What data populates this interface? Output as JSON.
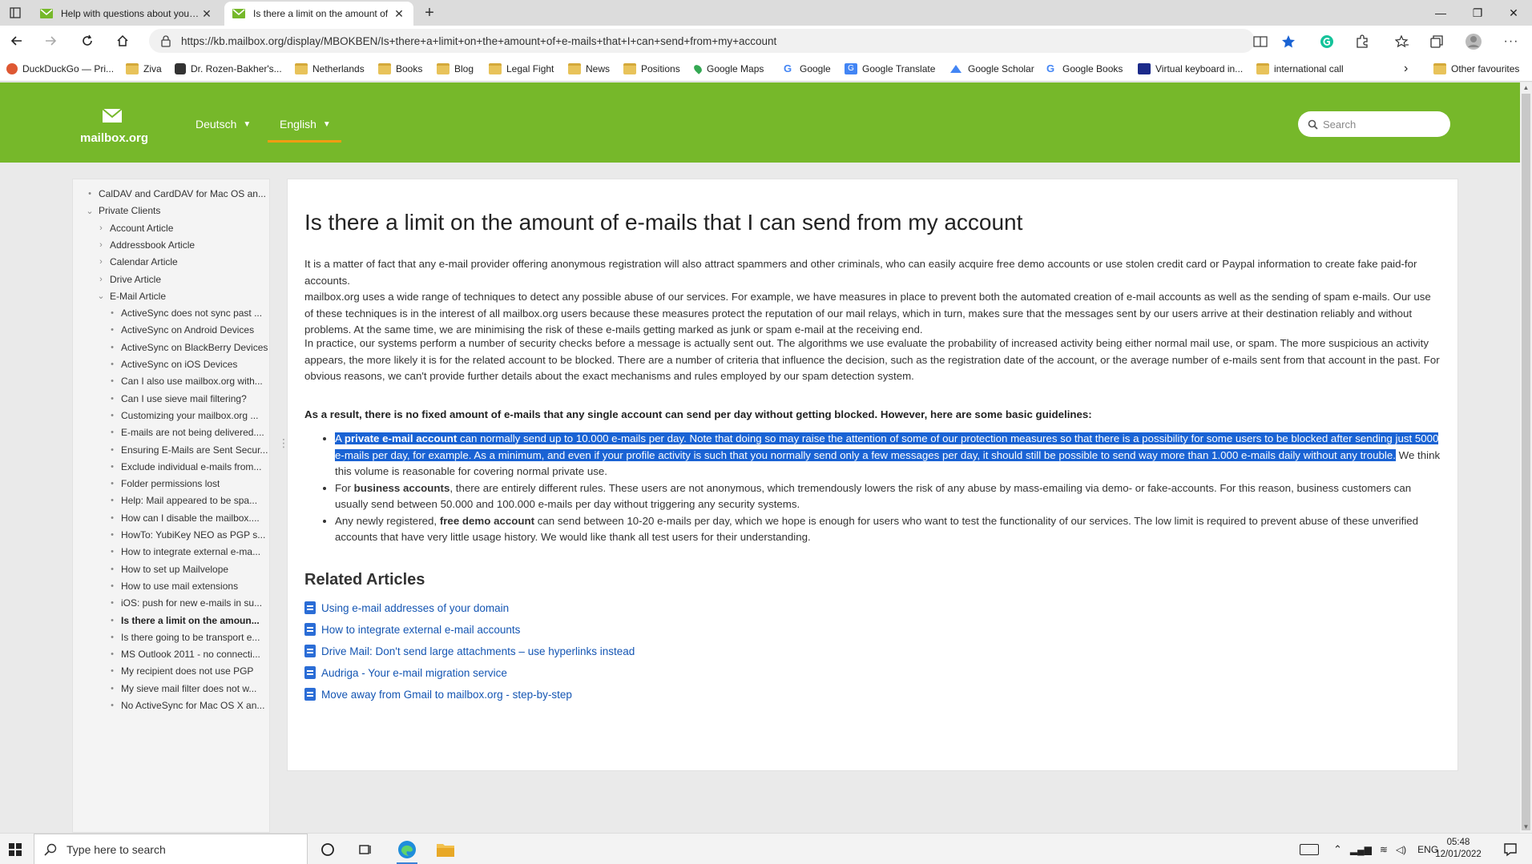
{
  "browser": {
    "tabs": [
      {
        "title": "Help with questions about your e",
        "active": false
      },
      {
        "title": "Is there a limit on the amount of",
        "active": true
      }
    ],
    "new_tab": "+",
    "window_controls": {
      "minimize": "—",
      "restore": "❐",
      "close": "✕"
    },
    "url": "https://kb.mailbox.org/display/MBOKBEN/Is+there+a+limit+on+the+amount+of+e-mails+that+I+can+send+from+my+account",
    "bookmarks": [
      {
        "label": "DuckDuckGo — Pri...",
        "icon": "duckduckgo-icon"
      },
      {
        "label": "Ziva",
        "icon": "folder-icon"
      },
      {
        "label": "Dr. Rozen-Bakher's...",
        "icon": "site-icon"
      },
      {
        "label": "Netherlands",
        "icon": "folder-icon"
      },
      {
        "label": "Books",
        "icon": "folder-icon"
      },
      {
        "label": "Blog",
        "icon": "folder-icon"
      },
      {
        "label": "Legal Fight",
        "icon": "folder-icon"
      },
      {
        "label": "News",
        "icon": "folder-icon"
      },
      {
        "label": "Positions",
        "icon": "folder-icon"
      },
      {
        "label": "Google Maps",
        "icon": "maps-icon"
      },
      {
        "label": "Google",
        "icon": "google-icon"
      },
      {
        "label": "Google Translate",
        "icon": "translate-icon"
      },
      {
        "label": "Google Scholar",
        "icon": "scholar-icon"
      },
      {
        "label": "Google Books",
        "icon": "google-icon"
      },
      {
        "label": "Virtual keyboard in...",
        "icon": "keyboard-icon"
      },
      {
        "label": "international call",
        "icon": "folder-icon"
      }
    ],
    "other_favourites": "Other favourites"
  },
  "site": {
    "logo": "mailbox.org",
    "languages": [
      "Deutsch",
      "English"
    ],
    "search_placeholder": "Search",
    "brand_color": "#76b82a"
  },
  "sidebar": {
    "items": [
      {
        "label": "CalDAV and CardDAV for Mac OS an...",
        "level": 0,
        "mark": "•"
      },
      {
        "label": "Private Clients",
        "level": 0,
        "mark": "⌄"
      },
      {
        "label": "Account Article",
        "level": 1,
        "mark": "›"
      },
      {
        "label": "Addressbook Article",
        "level": 1,
        "mark": "›"
      },
      {
        "label": "Calendar Article",
        "level": 1,
        "mark": "›"
      },
      {
        "label": "Drive Article",
        "level": 1,
        "mark": "›"
      },
      {
        "label": "E-Mail Article",
        "level": 1,
        "mark": "⌄"
      },
      {
        "label": "ActiveSync does not sync past ...",
        "level": 2,
        "mark": "•"
      },
      {
        "label": "ActiveSync on Android Devices",
        "level": 2,
        "mark": "•"
      },
      {
        "label": "ActiveSync on BlackBerry Devices",
        "level": 2,
        "mark": "•"
      },
      {
        "label": "ActiveSync on iOS Devices",
        "level": 2,
        "mark": "•"
      },
      {
        "label": "Can I also use mailbox.org with...",
        "level": 2,
        "mark": "•"
      },
      {
        "label": "Can I use sieve mail filtering?",
        "level": 2,
        "mark": "•"
      },
      {
        "label": "Customizing your mailbox.org ...",
        "level": 2,
        "mark": "•"
      },
      {
        "label": "E-mails are not being delivered....",
        "level": 2,
        "mark": "•"
      },
      {
        "label": "Ensuring E-Mails are Sent Secur...",
        "level": 2,
        "mark": "•"
      },
      {
        "label": "Exclude individual e-mails from...",
        "level": 2,
        "mark": "•"
      },
      {
        "label": "Folder permissions lost",
        "level": 2,
        "mark": "•"
      },
      {
        "label": "Help: Mail appeared to be spa...",
        "level": 2,
        "mark": "•"
      },
      {
        "label": "How can I disable the mailbox....",
        "level": 2,
        "mark": "•"
      },
      {
        "label": "HowTo: YubiKey NEO as PGP s...",
        "level": 2,
        "mark": "•"
      },
      {
        "label": "How to integrate external e-ma...",
        "level": 2,
        "mark": "•"
      },
      {
        "label": "How to set up Mailvelope",
        "level": 2,
        "mark": "•"
      },
      {
        "label": "How to use mail extensions",
        "level": 2,
        "mark": "•"
      },
      {
        "label": "iOS: push for new e-mails in su...",
        "level": 2,
        "mark": "•"
      },
      {
        "label": "Is there a limit on the amoun...",
        "level": 2,
        "mark": "•",
        "current": true
      },
      {
        "label": "Is there going to be transport e...",
        "level": 2,
        "mark": "•"
      },
      {
        "label": "MS Outlook 2011 - no connecti...",
        "level": 2,
        "mark": "•"
      },
      {
        "label": "My recipient does not use PGP",
        "level": 2,
        "mark": "•"
      },
      {
        "label": "My sieve mail filter does not w...",
        "level": 2,
        "mark": "•"
      },
      {
        "label": "No ActiveSync for Mac OS X an...",
        "level": 2,
        "mark": "•"
      }
    ]
  },
  "article": {
    "title": "Is there a limit on the amount of e-mails that I can send from my account",
    "paragraphs": [
      "It is a matter of fact that any e-mail provider offering anonymous registration will also attract spammers and other criminals, who can easily acquire free demo accounts or use stolen credit card or Paypal information to create fake paid-for accounts.",
      "mailbox.org uses a wide range of techniques to detect any possible abuse of our services. For example, we have measures in place to prevent both the automated creation of e-mail accounts as well as the sending of spam e-mails. Our use of these techniques is in the interest of all mailbox.org users because these measures protect the reputation of our mail relays, which in turn, makes sure that the messages sent by our users arrive at their destination reliably and without problems. At the same time, we are minimising the risk of these e-mails getting marked as junk or spam e-mail at the receiving end.",
      "In practice, our systems perform a number of security checks before a message is actually sent out. The algorithms we use evaluate the probability of increased activity being either normal mail use, or spam. The more suspicious an activity appears, the more likely it is for the related account to be blocked. There are a number of criteria that influence the decision, such as the registration date of the account, or the average number of e-mails sent from that account in the past. For obvious reasons, we can't provide further details about the exact mechanisms and rules employed by our spam detection system."
    ],
    "guidelines_heading": "As a result, there is no fixed amount of e-mails that any single account can send per day without getting blocked. However, here are some basic guidelines:",
    "bullets": [
      {
        "pre": "A ",
        "bold": "private e-mail account",
        "post_selected": " can normally send up to 10.000 e-mails per day. Note that doing so may raise the attention of some of our protection measures so that there is a possibility for some users to be blocked after sending just 5000 e-mails per day, for example. As a minimum, and even if your profile activity is such that you normally send only a few messages per day, it should still be possible to send way more than 1.000 e-mails daily without any trouble.",
        "post": " We think this volume is reasonable for covering normal private use."
      },
      {
        "pre": "For ",
        "bold": "business accounts",
        "post": ", there are entirely different rules. These users are not anonymous, which tremendously lowers the risk of any abuse by mass-emailing via demo- or fake-accounts. For this reason, business customers can usually send between 50.000 and 100.000 e-mails per day without triggering any security systems."
      },
      {
        "pre": "Any newly registered, ",
        "bold": "free demo account",
        "post": " can send between 10-20 e-mails per day, which we hope is enough for users who want to test the functionality of our services. The low limit is required to prevent abuse of these unverified accounts that have very little usage history. We would like thank all test users for their understanding."
      }
    ],
    "related_title": "Related Articles",
    "related": [
      "Using e-mail addresses of your domain",
      "How to integrate external e-mail accounts",
      "Drive Mail: Don't send large attachments – use hyperlinks instead",
      "Audriga - Your e-mail migration service",
      "Move away from Gmail to mailbox.org - step-by-step"
    ]
  },
  "taskbar": {
    "search_placeholder": "Type here to search",
    "language": "ENG",
    "time": "05:48",
    "date": "12/01/2022"
  }
}
